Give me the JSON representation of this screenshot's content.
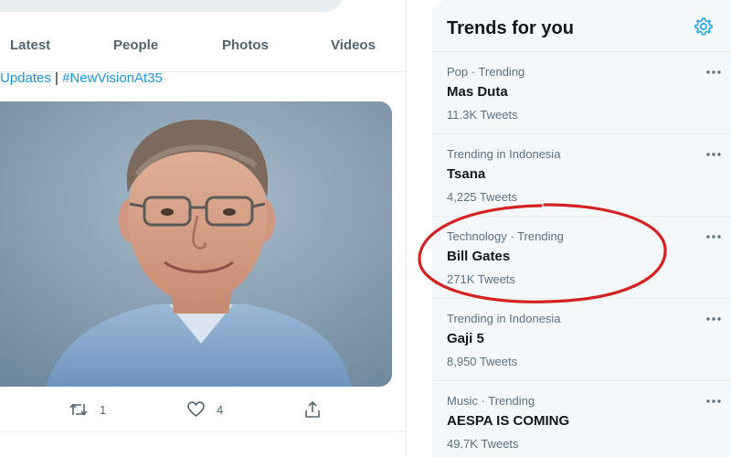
{
  "tabs": [
    {
      "label": "Latest"
    },
    {
      "label": "People"
    },
    {
      "label": "Photos"
    },
    {
      "label": "Videos"
    }
  ],
  "tweet": {
    "hashtag_1": "Updates",
    "separator": " | ",
    "hashtag_2": "#NewVisionAt35",
    "retweet_count": "1",
    "like_count": "4"
  },
  "trends": {
    "title": "Trends for you",
    "items": [
      {
        "meta": "Pop · Trending",
        "name": "Mas Duta",
        "count": "11.3K Tweets"
      },
      {
        "meta": "Trending in Indonesia",
        "name": "Tsana",
        "count": "4,225 Tweets"
      },
      {
        "meta": "Technology · Trending",
        "name": "Bill Gates",
        "count": "271K Tweets"
      },
      {
        "meta": "Trending in Indonesia",
        "name": "Gaji 5",
        "count": "8,950 Tweets"
      },
      {
        "meta": "Music · Trending",
        "name": "AESPA IS COMING",
        "count": "49.7K Tweets"
      }
    ]
  },
  "colors": {
    "accent": "#1da1f2",
    "annotation": "#d42222"
  },
  "icons": [
    "search-bar",
    "retweet-icon",
    "heart-icon",
    "share-icon",
    "gear-icon",
    "more-icon"
  ]
}
